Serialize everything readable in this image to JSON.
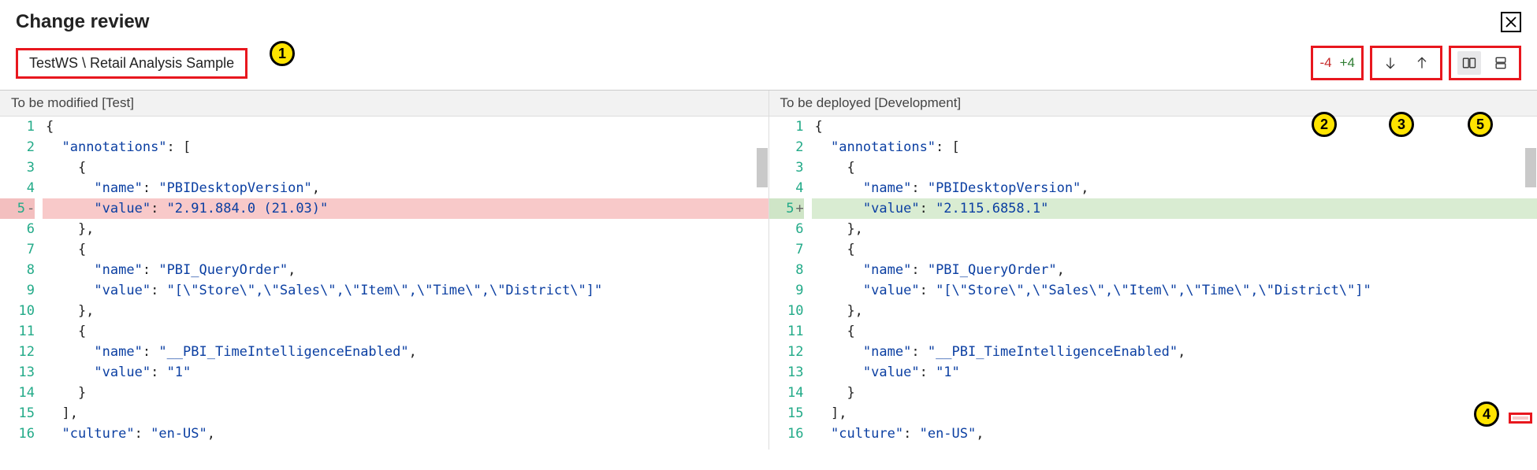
{
  "title": "Change review",
  "breadcrumb": "TestWS \\ Retail Analysis Sample",
  "diff_summary": {
    "removed": "-4",
    "added": "+4"
  },
  "panes": {
    "left": {
      "header": "To be modified [Test]"
    },
    "right": {
      "header": "To be deployed [Development]"
    }
  },
  "annotations": {
    "a1": "1",
    "a2": "2",
    "a3": "3",
    "a4": "4",
    "a5": "5"
  },
  "code": {
    "left": [
      {
        "n": 1,
        "kind": "",
        "tokens": [
          {
            "c": "t-punc",
            "t": "{"
          }
        ]
      },
      {
        "n": 2,
        "kind": "",
        "tokens": [
          {
            "c": "t-punc",
            "t": "  "
          },
          {
            "c": "t-key",
            "t": "\"annotations\""
          },
          {
            "c": "t-punc",
            "t": ": ["
          }
        ]
      },
      {
        "n": 3,
        "kind": "",
        "tokens": [
          {
            "c": "t-punc",
            "t": "    {"
          }
        ]
      },
      {
        "n": 4,
        "kind": "",
        "tokens": [
          {
            "c": "t-punc",
            "t": "      "
          },
          {
            "c": "t-key",
            "t": "\"name\""
          },
          {
            "c": "t-punc",
            "t": ": "
          },
          {
            "c": "t-str2",
            "t": "\"PBIDesktopVersion\""
          },
          {
            "c": "t-punc",
            "t": ","
          }
        ]
      },
      {
        "n": 5,
        "kind": "removed",
        "sign": "-",
        "tokens": [
          {
            "c": "t-punc",
            "t": "      "
          },
          {
            "c": "t-key",
            "t": "\"value\""
          },
          {
            "c": "t-punc",
            "t": ": "
          },
          {
            "c": "t-str2",
            "t": "\"2.91.884.0 (21.03)\""
          }
        ]
      },
      {
        "n": 6,
        "kind": "",
        "tokens": [
          {
            "c": "t-punc",
            "t": "    },"
          }
        ]
      },
      {
        "n": 7,
        "kind": "",
        "tokens": [
          {
            "c": "t-punc",
            "t": "    {"
          }
        ]
      },
      {
        "n": 8,
        "kind": "",
        "tokens": [
          {
            "c": "t-punc",
            "t": "      "
          },
          {
            "c": "t-key",
            "t": "\"name\""
          },
          {
            "c": "t-punc",
            "t": ": "
          },
          {
            "c": "t-str2",
            "t": "\"PBI_QueryOrder\""
          },
          {
            "c": "t-punc",
            "t": ","
          }
        ]
      },
      {
        "n": 9,
        "kind": "",
        "tokens": [
          {
            "c": "t-punc",
            "t": "      "
          },
          {
            "c": "t-key",
            "t": "\"value\""
          },
          {
            "c": "t-punc",
            "t": ": "
          },
          {
            "c": "t-str2",
            "t": "\"[\\\"Store\\\",\\\"Sales\\\",\\\"Item\\\",\\\"Time\\\",\\\"District\\\"]\""
          }
        ]
      },
      {
        "n": 10,
        "kind": "",
        "tokens": [
          {
            "c": "t-punc",
            "t": "    },"
          }
        ]
      },
      {
        "n": 11,
        "kind": "",
        "tokens": [
          {
            "c": "t-punc",
            "t": "    {"
          }
        ]
      },
      {
        "n": 12,
        "kind": "",
        "tokens": [
          {
            "c": "t-punc",
            "t": "      "
          },
          {
            "c": "t-key",
            "t": "\"name\""
          },
          {
            "c": "t-punc",
            "t": ": "
          },
          {
            "c": "t-str2",
            "t": "\"__PBI_TimeIntelligenceEnabled\""
          },
          {
            "c": "t-punc",
            "t": ","
          }
        ]
      },
      {
        "n": 13,
        "kind": "",
        "tokens": [
          {
            "c": "t-punc",
            "t": "      "
          },
          {
            "c": "t-key",
            "t": "\"value\""
          },
          {
            "c": "t-punc",
            "t": ": "
          },
          {
            "c": "t-str2",
            "t": "\"1\""
          }
        ]
      },
      {
        "n": 14,
        "kind": "",
        "tokens": [
          {
            "c": "t-punc",
            "t": "    }"
          }
        ]
      },
      {
        "n": 15,
        "kind": "",
        "tokens": [
          {
            "c": "t-punc",
            "t": "  ],"
          }
        ]
      },
      {
        "n": 16,
        "kind": "",
        "tokens": [
          {
            "c": "t-punc",
            "t": "  "
          },
          {
            "c": "t-key",
            "t": "\"culture\""
          },
          {
            "c": "t-punc",
            "t": ": "
          },
          {
            "c": "t-str2",
            "t": "\"en-US\""
          },
          {
            "c": "t-punc",
            "t": ","
          }
        ]
      }
    ],
    "right": [
      {
        "n": 1,
        "kind": "",
        "tokens": [
          {
            "c": "t-punc",
            "t": "{"
          }
        ]
      },
      {
        "n": 2,
        "kind": "",
        "tokens": [
          {
            "c": "t-punc",
            "t": "  "
          },
          {
            "c": "t-key",
            "t": "\"annotations\""
          },
          {
            "c": "t-punc",
            "t": ": ["
          }
        ]
      },
      {
        "n": 3,
        "kind": "",
        "tokens": [
          {
            "c": "t-punc",
            "t": "    {"
          }
        ]
      },
      {
        "n": 4,
        "kind": "",
        "tokens": [
          {
            "c": "t-punc",
            "t": "      "
          },
          {
            "c": "t-key",
            "t": "\"name\""
          },
          {
            "c": "t-punc",
            "t": ": "
          },
          {
            "c": "t-str2",
            "t": "\"PBIDesktopVersion\""
          },
          {
            "c": "t-punc",
            "t": ","
          }
        ]
      },
      {
        "n": 5,
        "kind": "added",
        "sign": "+",
        "tokens": [
          {
            "c": "t-punc",
            "t": "      "
          },
          {
            "c": "t-key",
            "t": "\"value\""
          },
          {
            "c": "t-punc",
            "t": ": "
          },
          {
            "c": "t-str2",
            "t": "\"2.115.6858.1\""
          }
        ]
      },
      {
        "n": 6,
        "kind": "",
        "tokens": [
          {
            "c": "t-punc",
            "t": "    },"
          }
        ]
      },
      {
        "n": 7,
        "kind": "",
        "tokens": [
          {
            "c": "t-punc",
            "t": "    {"
          }
        ]
      },
      {
        "n": 8,
        "kind": "",
        "tokens": [
          {
            "c": "t-punc",
            "t": "      "
          },
          {
            "c": "t-key",
            "t": "\"name\""
          },
          {
            "c": "t-punc",
            "t": ": "
          },
          {
            "c": "t-str2",
            "t": "\"PBI_QueryOrder\""
          },
          {
            "c": "t-punc",
            "t": ","
          }
        ]
      },
      {
        "n": 9,
        "kind": "",
        "tokens": [
          {
            "c": "t-punc",
            "t": "      "
          },
          {
            "c": "t-key",
            "t": "\"value\""
          },
          {
            "c": "t-punc",
            "t": ": "
          },
          {
            "c": "t-str2",
            "t": "\"[\\\"Store\\\",\\\"Sales\\\",\\\"Item\\\",\\\"Time\\\",\\\"District\\\"]\""
          }
        ]
      },
      {
        "n": 10,
        "kind": "",
        "tokens": [
          {
            "c": "t-punc",
            "t": "    },"
          }
        ]
      },
      {
        "n": 11,
        "kind": "",
        "tokens": [
          {
            "c": "t-punc",
            "t": "    {"
          }
        ]
      },
      {
        "n": 12,
        "kind": "",
        "tokens": [
          {
            "c": "t-punc",
            "t": "      "
          },
          {
            "c": "t-key",
            "t": "\"name\""
          },
          {
            "c": "t-punc",
            "t": ": "
          },
          {
            "c": "t-str2",
            "t": "\"__PBI_TimeIntelligenceEnabled\""
          },
          {
            "c": "t-punc",
            "t": ","
          }
        ]
      },
      {
        "n": 13,
        "kind": "",
        "tokens": [
          {
            "c": "t-punc",
            "t": "      "
          },
          {
            "c": "t-key",
            "t": "\"value\""
          },
          {
            "c": "t-punc",
            "t": ": "
          },
          {
            "c": "t-str2",
            "t": "\"1\""
          }
        ]
      },
      {
        "n": 14,
        "kind": "",
        "tokens": [
          {
            "c": "t-punc",
            "t": "    }"
          }
        ]
      },
      {
        "n": 15,
        "kind": "",
        "tokens": [
          {
            "c": "t-punc",
            "t": "  ],"
          }
        ]
      },
      {
        "n": 16,
        "kind": "",
        "tokens": [
          {
            "c": "t-punc",
            "t": "  "
          },
          {
            "c": "t-key",
            "t": "\"culture\""
          },
          {
            "c": "t-punc",
            "t": ": "
          },
          {
            "c": "t-str2",
            "t": "\"en-US\""
          },
          {
            "c": "t-punc",
            "t": ","
          }
        ]
      }
    ]
  }
}
